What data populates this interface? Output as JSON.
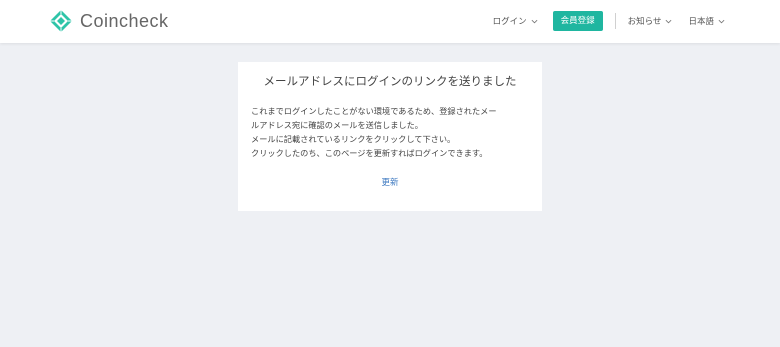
{
  "brand": {
    "name": "Coincheck",
    "logo_icon": "coincheck-diamond-icon",
    "colors": {
      "accent": "#1fb6a0",
      "link": "#3c78c0",
      "background": "#eef0f4"
    }
  },
  "nav": {
    "login_label": "ログイン",
    "register_label": "会員登録",
    "news_label": "お知らせ",
    "language_label": "日本語"
  },
  "card": {
    "title": "メールアドレスにログインのリンクを送りました",
    "lines": [
      "これまでログインしたことがない環境であるため、登録されたメー",
      "ルアドレス宛に確認のメールを送信しました。",
      "メールに記載されているリンクをクリックして下さい。",
      "クリックしたのち、このページを更新すればログインできます。"
    ],
    "update_label": "更新"
  }
}
